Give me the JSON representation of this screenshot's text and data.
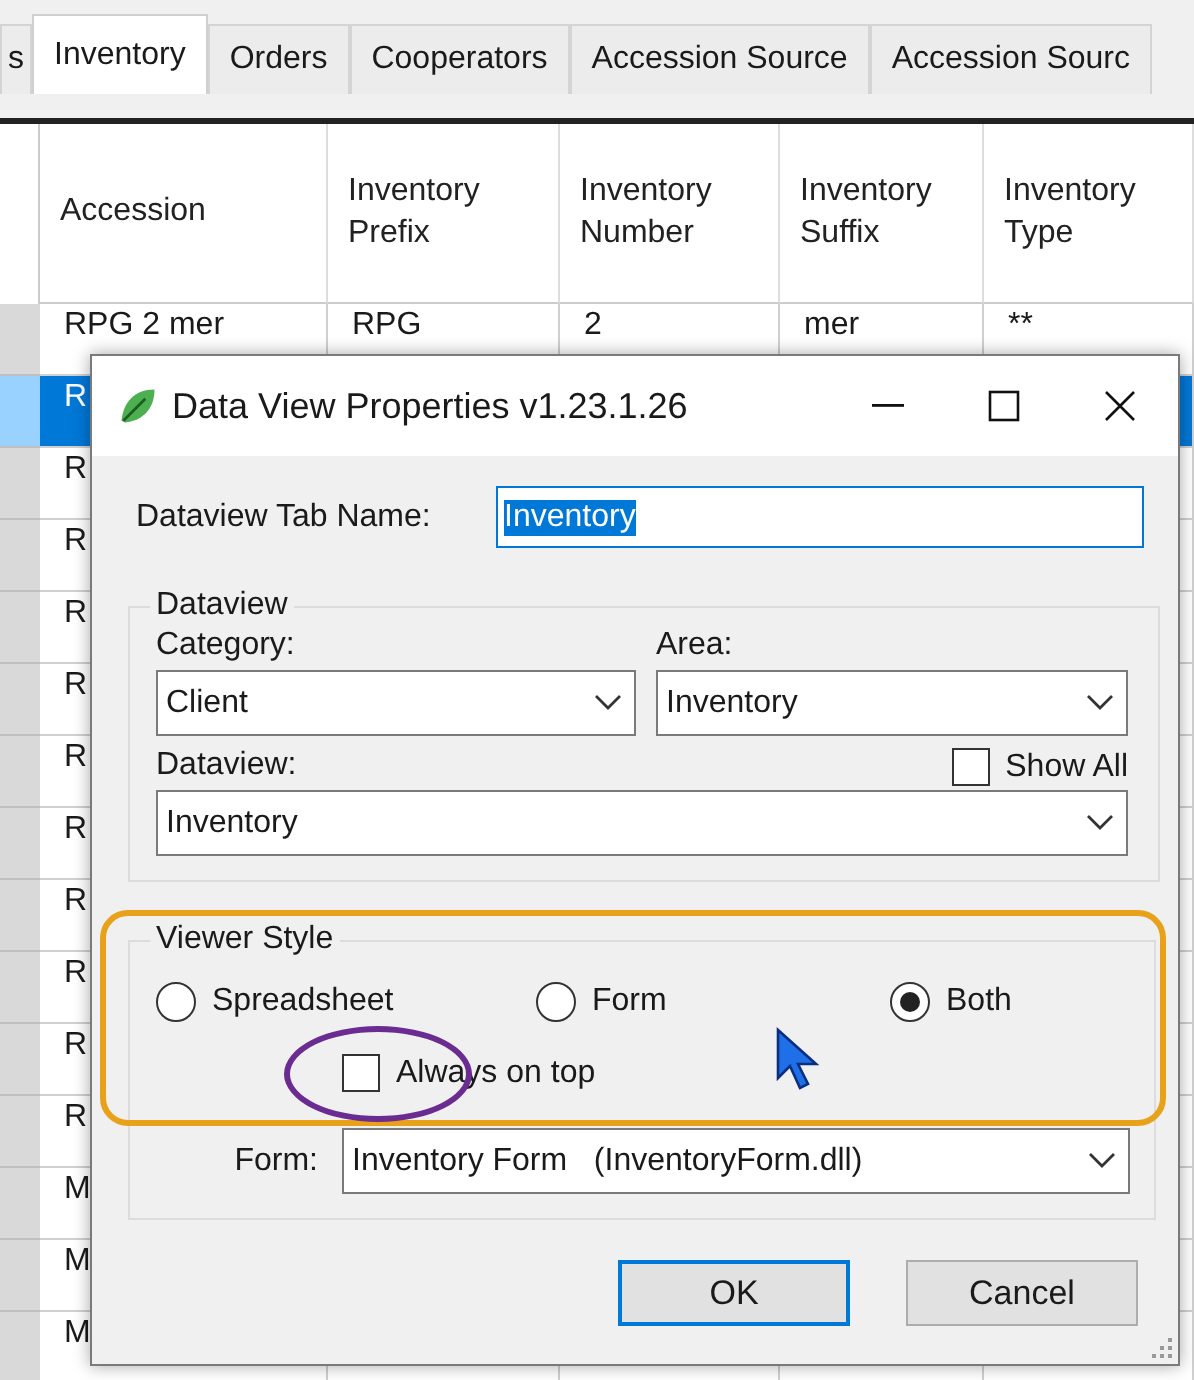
{
  "app_tabs": [
    {
      "label": "s",
      "selected": false
    },
    {
      "label": "Inventory",
      "selected": true
    },
    {
      "label": "Orders",
      "selected": false
    },
    {
      "label": "Cooperators",
      "selected": false
    },
    {
      "label": "Accession Source",
      "selected": false
    },
    {
      "label": "Accession Sourc",
      "selected": false
    }
  ],
  "table": {
    "columns": [
      "Accession",
      "Inventory Prefix",
      "Inventory Number",
      "Inventory Suffix",
      "Inventory Type"
    ],
    "rows": [
      {
        "cells": [
          "RPG 2 mer",
          "RPG",
          "2",
          "mer",
          "**"
        ],
        "selected": false
      },
      {
        "cells": [
          "R"
        ],
        "selected": true
      },
      {
        "cells": [
          "R"
        ],
        "selected": false
      },
      {
        "cells": [
          "R"
        ],
        "selected": false
      },
      {
        "cells": [
          "R"
        ],
        "selected": false
      },
      {
        "cells": [
          "R"
        ],
        "selected": false
      },
      {
        "cells": [
          "R"
        ],
        "selected": false
      },
      {
        "cells": [
          "R"
        ],
        "selected": false
      },
      {
        "cells": [
          "R"
        ],
        "selected": false
      },
      {
        "cells": [
          "R"
        ],
        "selected": false
      },
      {
        "cells": [
          "R"
        ],
        "selected": false
      },
      {
        "cells": [
          "R"
        ],
        "selected": false
      },
      {
        "cells": [
          "M"
        ],
        "selected": false
      },
      {
        "cells": [
          "M"
        ],
        "selected": false
      },
      {
        "cells": [
          "M"
        ],
        "selected": false
      }
    ]
  },
  "dialog": {
    "title": "Data View Properties v1.23.1.26",
    "tab_name": {
      "label": "Dataview Tab Name:",
      "value": "Inventory",
      "text_selected": true
    },
    "dataview_group": {
      "legend": "Dataview",
      "category": {
        "label": "Category:",
        "value": "Client"
      },
      "area": {
        "label": "Area:",
        "value": "Inventory"
      },
      "dataview": {
        "label": "Dataview:",
        "value": "Inventory"
      },
      "show_all": {
        "label": "Show All",
        "checked": false
      }
    },
    "viewer_style": {
      "legend": "Viewer Style",
      "options": [
        {
          "label": "Spreadsheet",
          "selected": false
        },
        {
          "label": "Form",
          "selected": false
        },
        {
          "label": "Both",
          "selected": true
        }
      ],
      "always_on_top": {
        "label": "Always on top",
        "checked": false
      },
      "form": {
        "label": "Form:",
        "value": "Inventory Form   (InventoryForm.dll)"
      }
    },
    "buttons": [
      {
        "label": "OK",
        "default": true
      },
      {
        "label": "Cancel",
        "default": false
      }
    ]
  }
}
